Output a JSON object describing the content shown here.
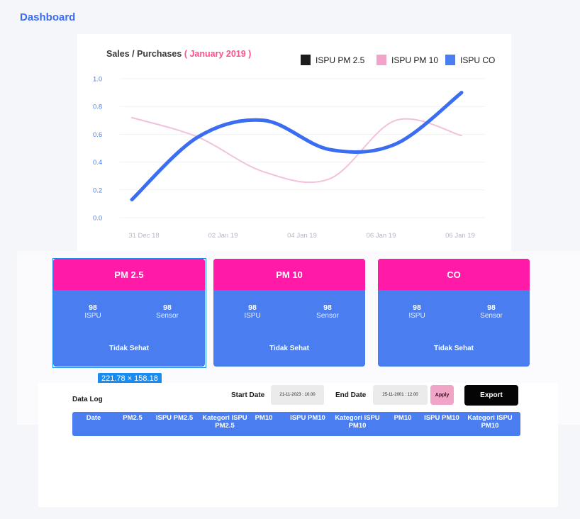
{
  "page": {
    "title": "Dashboard"
  },
  "chart": {
    "title_main": "Sales / Purchases",
    "title_accent": "( January 2019 )",
    "legend": [
      {
        "label": "ISPU PM 2.5",
        "color": "#1c1c1c"
      },
      {
        "label": "ISPU PM 10",
        "color": "#f2a3c8"
      },
      {
        "label": "ISPU CO",
        "color": "#4a7ef0"
      }
    ]
  },
  "chart_data": {
    "type": "line",
    "x": [
      "31 Dec 18",
      "02 Jan 19",
      "04 Jan 19",
      "06 Jan 19",
      "06 Jan 19"
    ],
    "y_ticks": [
      "1.0",
      "0.8",
      "0.6",
      "0.4",
      "0.2",
      "0.0"
    ],
    "ylim": [
      0,
      1
    ],
    "series": [
      {
        "name": "ISPU PM 10",
        "color": "#f2c1db",
        "values": [
          0.72,
          0.58,
          0.33,
          0.28,
          0.7,
          0.59
        ]
      },
      {
        "name": "ISPU CO",
        "color": "#3b6df2",
        "values": [
          0.13,
          0.58,
          0.7,
          0.49,
          0.53,
          0.9
        ]
      }
    ]
  },
  "cards": [
    {
      "title": "PM 2.5",
      "ispu_value": "98",
      "ispu_label": "ISPU",
      "sensor_value": "98",
      "sensor_label": "Sensor",
      "status": "Tidak Sehat"
    },
    {
      "title": "PM 10",
      "ispu_value": "98",
      "ispu_label": "ISPU",
      "sensor_value": "98",
      "sensor_label": "Sensor",
      "status": "Tidak Sehat"
    },
    {
      "title": "CO",
      "ispu_value": "98",
      "ispu_label": "ISPU",
      "sensor_value": "98",
      "sensor_label": "Sensor",
      "status": "Tidak Sehat"
    }
  ],
  "selection": {
    "dimensions": "221.78 × 158.18"
  },
  "log": {
    "title": "Data Log",
    "start_label": "Start Date",
    "start_value": "21-11-2023 : 10.00",
    "end_label": "End Date",
    "end_value": "25-11-2001 : 12.00",
    "apply_label": "Apply",
    "export_label": "Export",
    "columns": [
      "Date",
      "PM2.5",
      "ISPU PM2.5",
      "Kategori ISPU PM2.5",
      "PM10",
      "ISPU PM10",
      "Kategori ISPU PM10",
      "PM10",
      "ISPU PM10",
      "Kategori ISPU PM10"
    ]
  }
}
